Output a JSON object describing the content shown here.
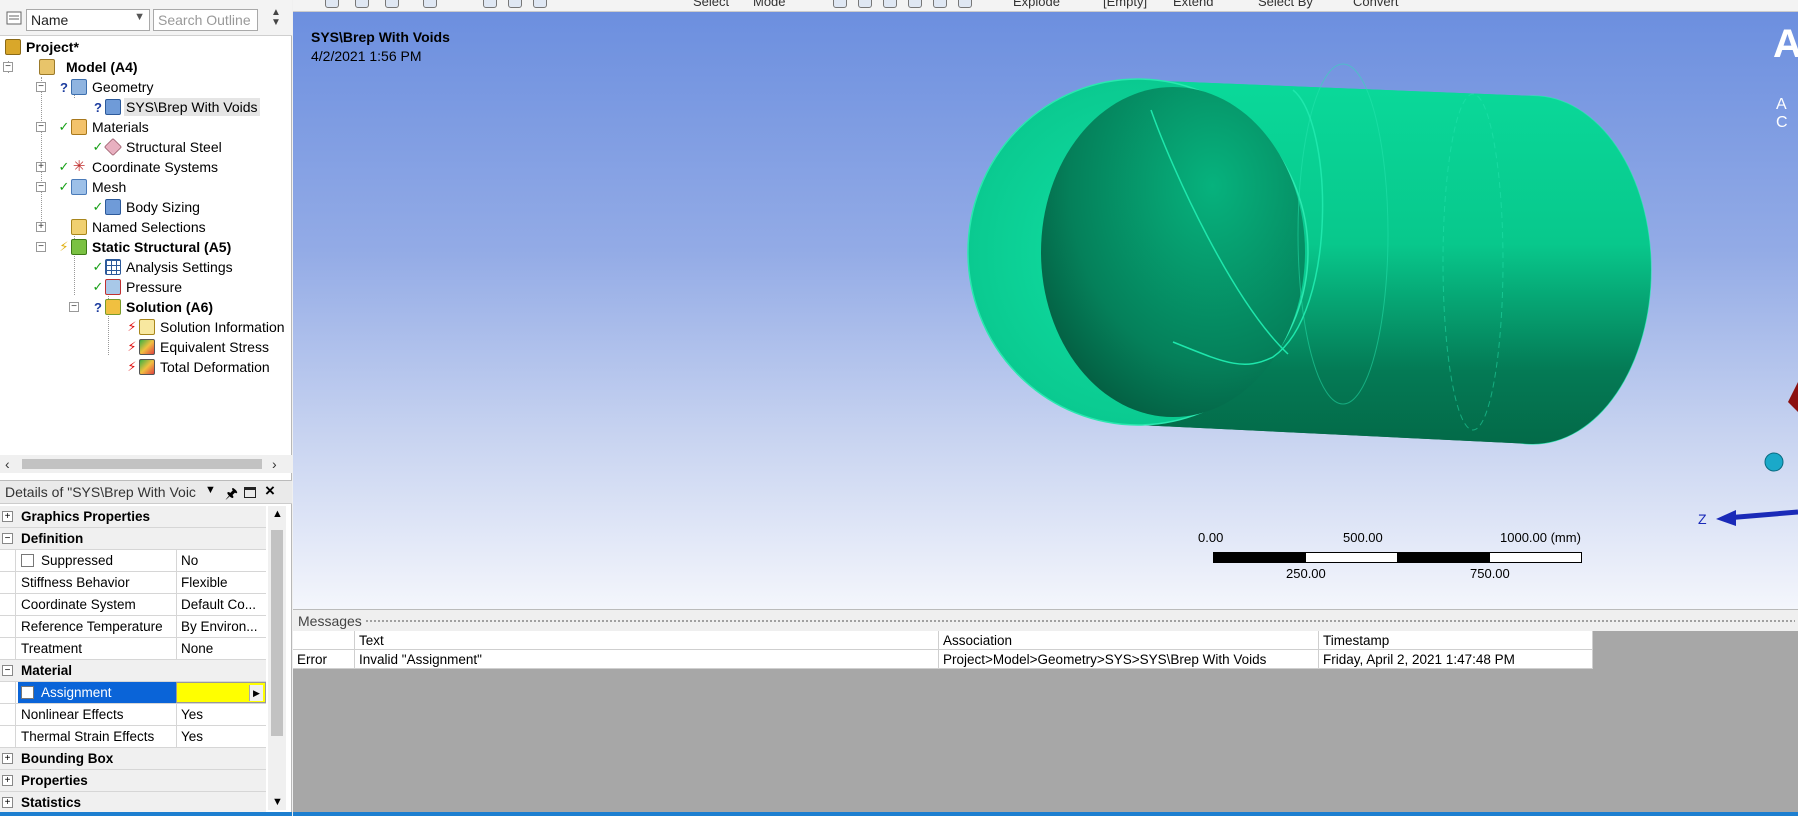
{
  "outline": {
    "name_filter": "Name",
    "search_placeholder": "Search Outline",
    "tree": [
      {
        "label": "Project*",
        "status": "",
        "icon": "project-icon"
      },
      {
        "label": "Model (A4)",
        "status": "",
        "icon": "model-icon"
      },
      {
        "label": "Geometry",
        "status": "?",
        "icon": "geometry-icon"
      },
      {
        "label": "SYS\\Brep With Voids",
        "status": "?",
        "icon": "body-icon"
      },
      {
        "label": "Materials",
        "status": "✓",
        "icon": "materials-icon"
      },
      {
        "label": "Structural Steel",
        "status": "✓",
        "icon": "material-tag-icon"
      },
      {
        "label": "Coordinate Systems",
        "status": "✓",
        "icon": "coordinate-systems-icon"
      },
      {
        "label": "Mesh",
        "status": "✓",
        "icon": "mesh-icon"
      },
      {
        "label": "Body Sizing",
        "status": "✓",
        "icon": "body-sizing-icon"
      },
      {
        "label": "Named Selections",
        "status": "",
        "icon": "named-selections-icon"
      },
      {
        "label": "Static Structural (A5)",
        "status": "⚡",
        "icon": "static-structural-icon"
      },
      {
        "label": "Analysis Settings",
        "status": "✓",
        "icon": "analysis-settings-icon"
      },
      {
        "label": "Pressure",
        "status": "✓",
        "icon": "pressure-icon"
      },
      {
        "label": "Solution (A6)",
        "status": "?",
        "icon": "solution-icon"
      },
      {
        "label": "Solution Information",
        "status": "⚡",
        "icon": "solution-information-icon"
      },
      {
        "label": "Equivalent Stress",
        "status": "⚡",
        "icon": "equivalent-stress-icon"
      },
      {
        "label": "Total Deformation",
        "status": "⚡",
        "icon": "total-deformation-icon"
      }
    ]
  },
  "details": {
    "title": "Details of \"SYS\\Brep With Voic",
    "rows": [
      {
        "type": "cat",
        "label": "Graphics Properties",
        "sign": "+"
      },
      {
        "type": "cat",
        "label": "Definition",
        "sign": "−"
      },
      {
        "type": "prop",
        "label": "Suppressed",
        "value": "No"
      },
      {
        "type": "prop",
        "label": "Stiffness Behavior",
        "value": "Flexible"
      },
      {
        "type": "prop",
        "label": "Coordinate System",
        "value": "Default Co..."
      },
      {
        "type": "prop",
        "label": "Reference Temperature",
        "value": "By Environ..."
      },
      {
        "type": "prop",
        "label": "Treatment",
        "value": "None"
      },
      {
        "type": "cat",
        "label": "Material",
        "sign": "−"
      },
      {
        "type": "prop",
        "label": "Assignment",
        "value": ""
      },
      {
        "type": "prop",
        "label": "Nonlinear Effects",
        "value": "Yes"
      },
      {
        "type": "prop",
        "label": "Thermal Strain Effects",
        "value": "Yes"
      },
      {
        "type": "cat",
        "label": "Bounding Box",
        "sign": "+"
      },
      {
        "type": "cat",
        "label": "Properties",
        "sign": "+"
      },
      {
        "type": "cat",
        "label": "Statistics",
        "sign": "+"
      }
    ]
  },
  "toolbar": {
    "labels": [
      "Select",
      "Mode",
      "Explode",
      "[Empty]",
      "Extend",
      "Select By",
      "Convert"
    ]
  },
  "viewport": {
    "title": "SYS\\Brep With Voids",
    "date": "4/2/2021 1:56 PM",
    "logo": "A",
    "logo_sub": "A C",
    "model_color": "#0adb9b",
    "background_top": "#6c8fdf",
    "background_bottom": "#f4f6fc",
    "scale": {
      "top_labels": [
        "0.00",
        "500.00",
        "1000.00 (mm)"
      ],
      "bottom_labels": [
        "250.00",
        "750.00"
      ]
    },
    "triad_axis_label": "Z"
  },
  "messages": {
    "title": "Messages",
    "columns": [
      "",
      "Text",
      "Association",
      "Timestamp"
    ],
    "rows": [
      {
        "level": "Error",
        "text": "Invalid \"Assignment\"",
        "association": "Project>Model>Geometry>SYS>SYS\\Brep With Voids",
        "timestamp": "Friday, April 2, 2021 1:47:48 PM"
      }
    ]
  }
}
